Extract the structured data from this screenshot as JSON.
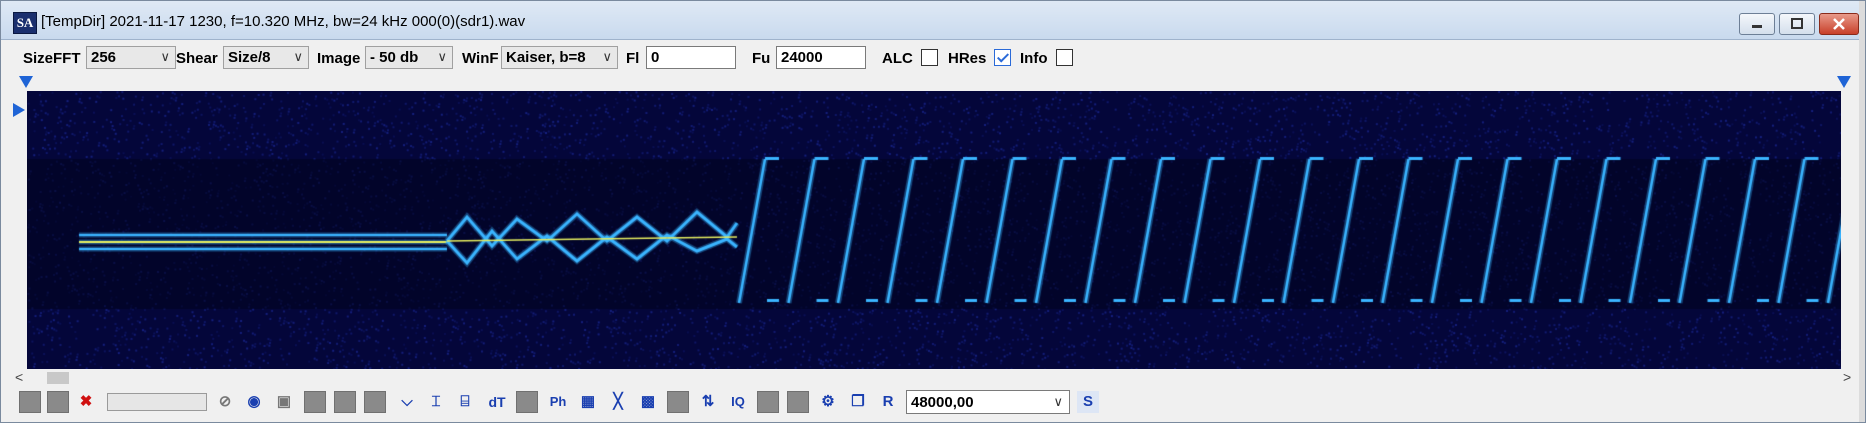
{
  "window": {
    "title": "[TempDir] 2021-11-17 1230, f=10.320 MHz, bw=24 kHz 000(0)(sdr1).wav",
    "app_icon": "SA"
  },
  "toolbar": {
    "sizefft_label": "SizeFFT",
    "sizefft_value": "256",
    "shear_label": "Shear",
    "shear_value": "Size/8",
    "image_label": "Image",
    "image_value": "- 50 db",
    "winf_label": "WinF",
    "winf_value": "Kaiser, b=8",
    "fl_label": "Fl",
    "fl_value": "0",
    "fu_label": "Fu",
    "fu_value": "24000",
    "alc_label": "ALC",
    "alc_checked": false,
    "hres_label": "HRes",
    "hres_checked": true,
    "info_label": "Info",
    "info_checked": false
  },
  "bottom_toolbar": {
    "r_label": "R",
    "sample_rate": "48000,00",
    "s_label": "S",
    "dt_label": "dT",
    "iq_label": "IQ",
    "ph_label": "Ph"
  },
  "spectrogram": {
    "colors": {
      "background": "#04063a",
      "trace_bright": "#e8f060",
      "trace": "#3ab4ff"
    }
  }
}
